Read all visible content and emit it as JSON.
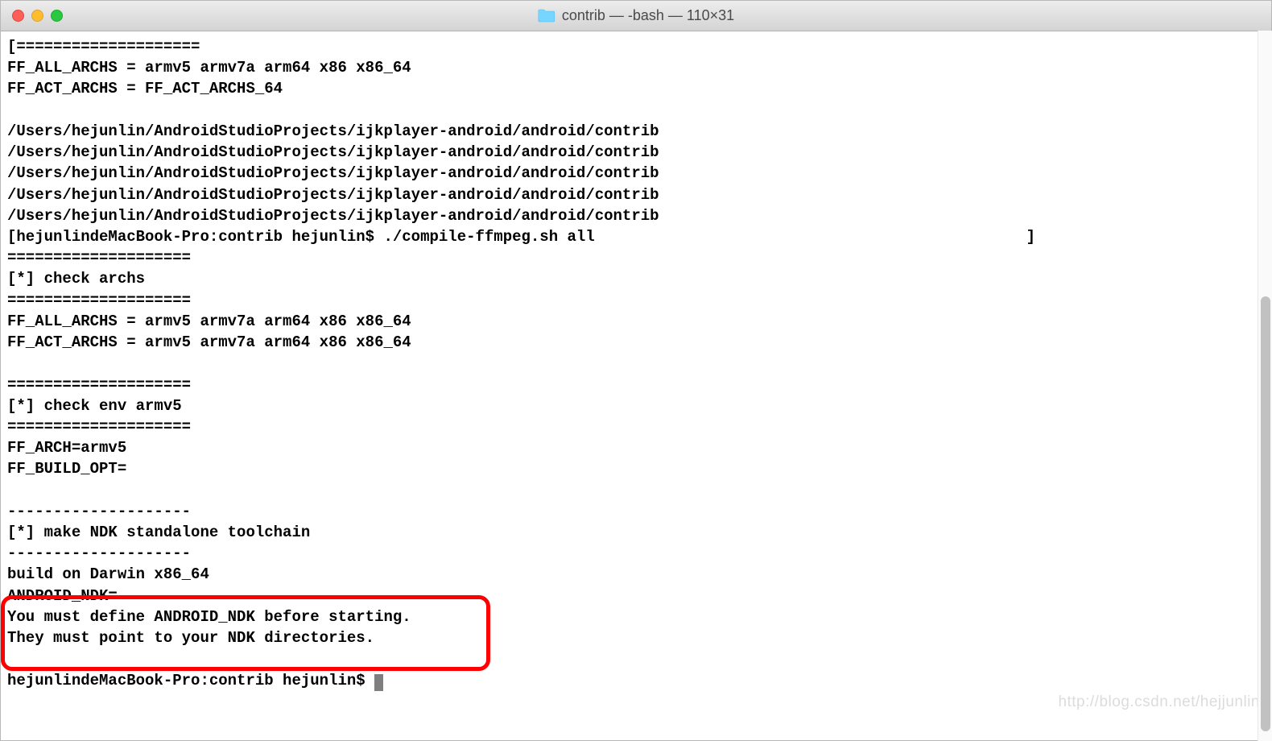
{
  "window": {
    "title": "contrib — -bash — 110×31"
  },
  "terminal": {
    "lines": [
      "[====================",
      "FF_ALL_ARCHS = armv5 armv7a arm64 x86 x86_64",
      "FF_ACT_ARCHS = FF_ACT_ARCHS_64",
      "",
      "/Users/hejunlin/AndroidStudioProjects/ijkplayer-android/android/contrib",
      "/Users/hejunlin/AndroidStudioProjects/ijkplayer-android/android/contrib",
      "/Users/hejunlin/AndroidStudioProjects/ijkplayer-android/android/contrib",
      "/Users/hejunlin/AndroidStudioProjects/ijkplayer-android/android/contrib",
      "/Users/hejunlin/AndroidStudioProjects/ijkplayer-android/android/contrib",
      "[hejunlindeMacBook-Pro:contrib hejunlin$ ./compile-ffmpeg.sh all                                               ]",
      "====================",
      "[*] check archs",
      "====================",
      "FF_ALL_ARCHS = armv5 armv7a arm64 x86 x86_64",
      "FF_ACT_ARCHS = armv5 armv7a arm64 x86 x86_64",
      "",
      "====================",
      "[*] check env armv5",
      "====================",
      "FF_ARCH=armv5",
      "FF_BUILD_OPT=",
      "",
      "--------------------",
      "[*] make NDK standalone toolchain",
      "--------------------",
      "build on Darwin x86_64",
      "ANDROID_NDK=",
      "You must define ANDROID_NDK before starting.",
      "They must point to your NDK directories.",
      ""
    ],
    "prompt": "hejunlindeMacBook-Pro:contrib hejunlin$ "
  },
  "watermark": "http://blog.csdn.net/hejjunlin"
}
